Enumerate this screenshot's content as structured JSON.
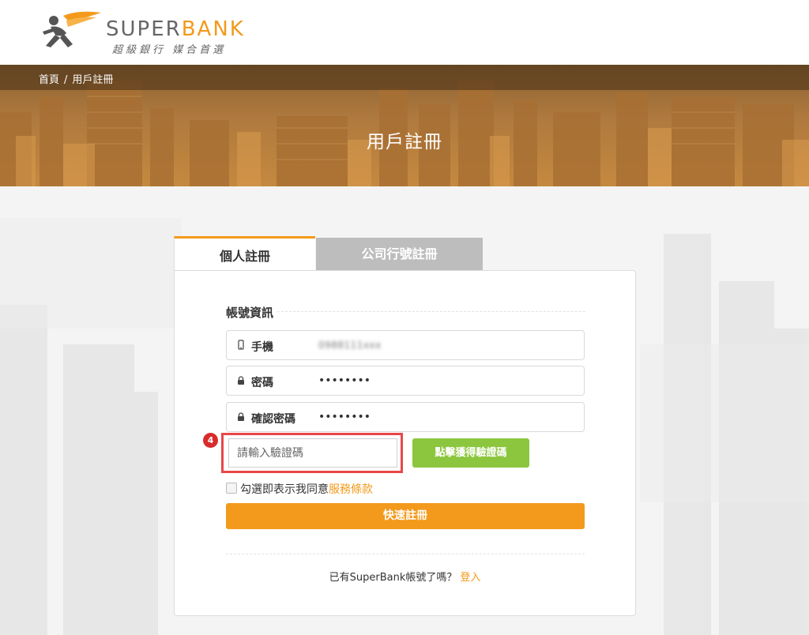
{
  "header": {
    "brand_prefix": "SUPER",
    "brand_suffix": "BANK",
    "tagline": "超級銀行  媒合首選"
  },
  "breadcrumb": {
    "home": "首頁",
    "separator": "/",
    "current": "用戶註冊"
  },
  "hero": {
    "title": "用戶註冊"
  },
  "tabs": [
    {
      "label": "個人註冊",
      "active": true
    },
    {
      "label": "公司行號註冊",
      "active": false
    }
  ],
  "form": {
    "section_title": "帳號資訊",
    "phone": {
      "label": "手機",
      "value": "0988111xxx",
      "icon": "mobile-icon"
    },
    "password": {
      "label": "密碼",
      "value": "••••••••",
      "icon": "lock-icon"
    },
    "confirm_password": {
      "label": "確認密碼",
      "value": "••••••••",
      "icon": "lock-icon"
    },
    "verification": {
      "placeholder": "請輸入驗證碼",
      "button_label": "點擊獲得驗證碼",
      "step_number": "4"
    },
    "agree": {
      "text": "勾選即表示我同意",
      "link_text": "服務條款",
      "checked": false
    },
    "submit_label": "快速註冊",
    "login_prompt": "已有SuperBank帳號了嗎？",
    "login_link": "登入"
  },
  "colors": {
    "accent": "#f39a1c",
    "green_button": "#8cc63e",
    "highlight_red": "#e8474a",
    "tab_inactive": "#bdbdbd"
  }
}
